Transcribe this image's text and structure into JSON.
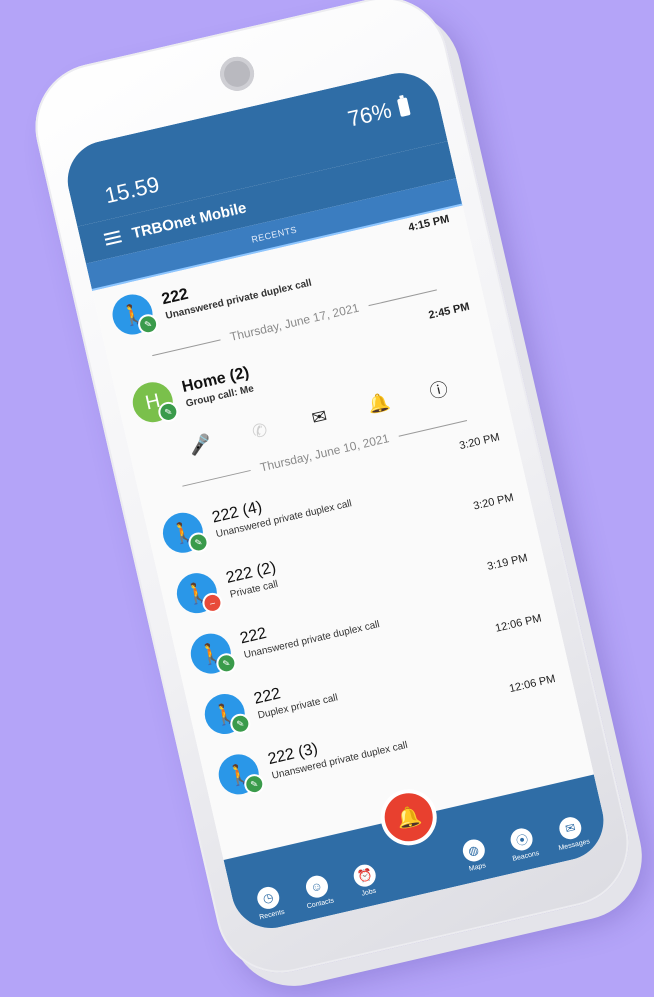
{
  "status": {
    "time": "15.59",
    "battery": "76%"
  },
  "app": {
    "title": "TRBOnet Mobile",
    "tab": "RECENTS"
  },
  "recents": {
    "top": {
      "time": "4:15 PM",
      "name": "222",
      "desc": "Unanswered private duplex call"
    },
    "sep1": "Thursday, June 17, 2021",
    "group": {
      "time": "2:45 PM",
      "name": "Home (2)",
      "desc": "Group call: Me",
      "initial": "H"
    },
    "sep2": "Thursday, June 10, 2021",
    "items": [
      {
        "time": "3:20 PM",
        "name": "222 (4)",
        "desc": "Unanswered private duplex call"
      },
      {
        "time": "3:20 PM",
        "name": "222 (2)",
        "desc": "Private call"
      },
      {
        "time": "3:19 PM",
        "name": "222",
        "desc": "Unanswered private duplex call"
      },
      {
        "time": "12:06 PM",
        "name": "222",
        "desc": "Duplex private call"
      },
      {
        "time": "12:06 PM",
        "name": "222 (3)",
        "desc": "Unanswered private duplex call"
      }
    ]
  },
  "nav": {
    "recents": "Recents",
    "contacts": "Contacts",
    "jobs": "Jobs",
    "maps": "Maps",
    "beacons": "Beacons",
    "messages": "Messages"
  },
  "icons": {
    "walk": "🚶",
    "badge_ok": "✎",
    "badge_blocked": "–"
  }
}
